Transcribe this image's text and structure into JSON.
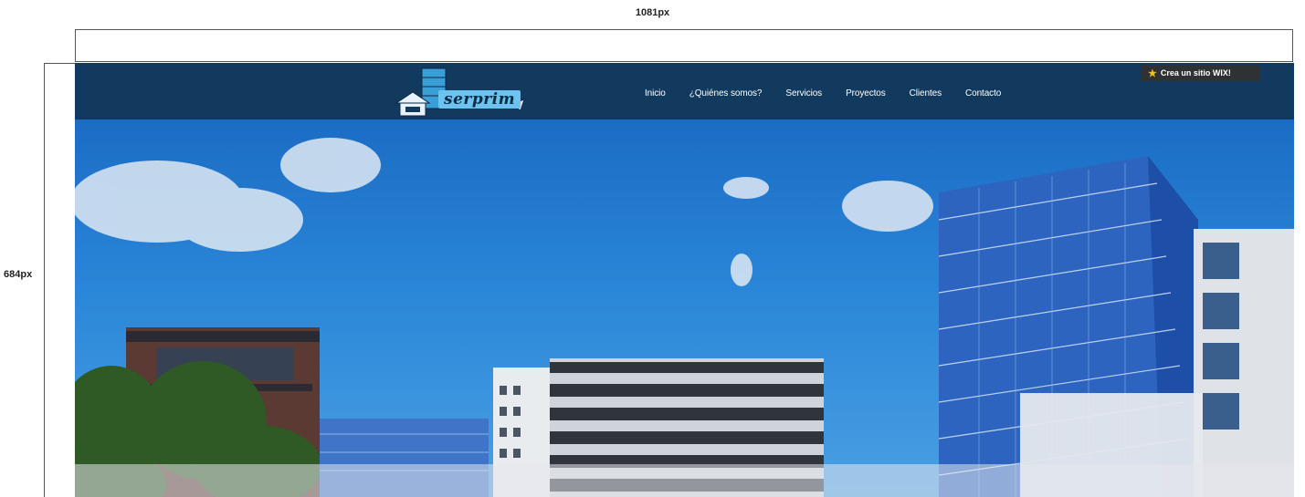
{
  "annotations": {
    "width_label": "1081px",
    "height_label": "684px"
  },
  "site": {
    "logo_text": "serprim",
    "nav": [
      "Inicio",
      "¿Quiénes somos?",
      "Servicios",
      "Proyectos",
      "Clientes",
      "Contacto"
    ],
    "wix_banner": "Crea un sitio WIX!",
    "colors": {
      "navbar": "#123a5e",
      "sky": "#2a86d8",
      "logo_accent": "#6cc3ef",
      "wix_banner_bg": "#2f3235"
    }
  }
}
